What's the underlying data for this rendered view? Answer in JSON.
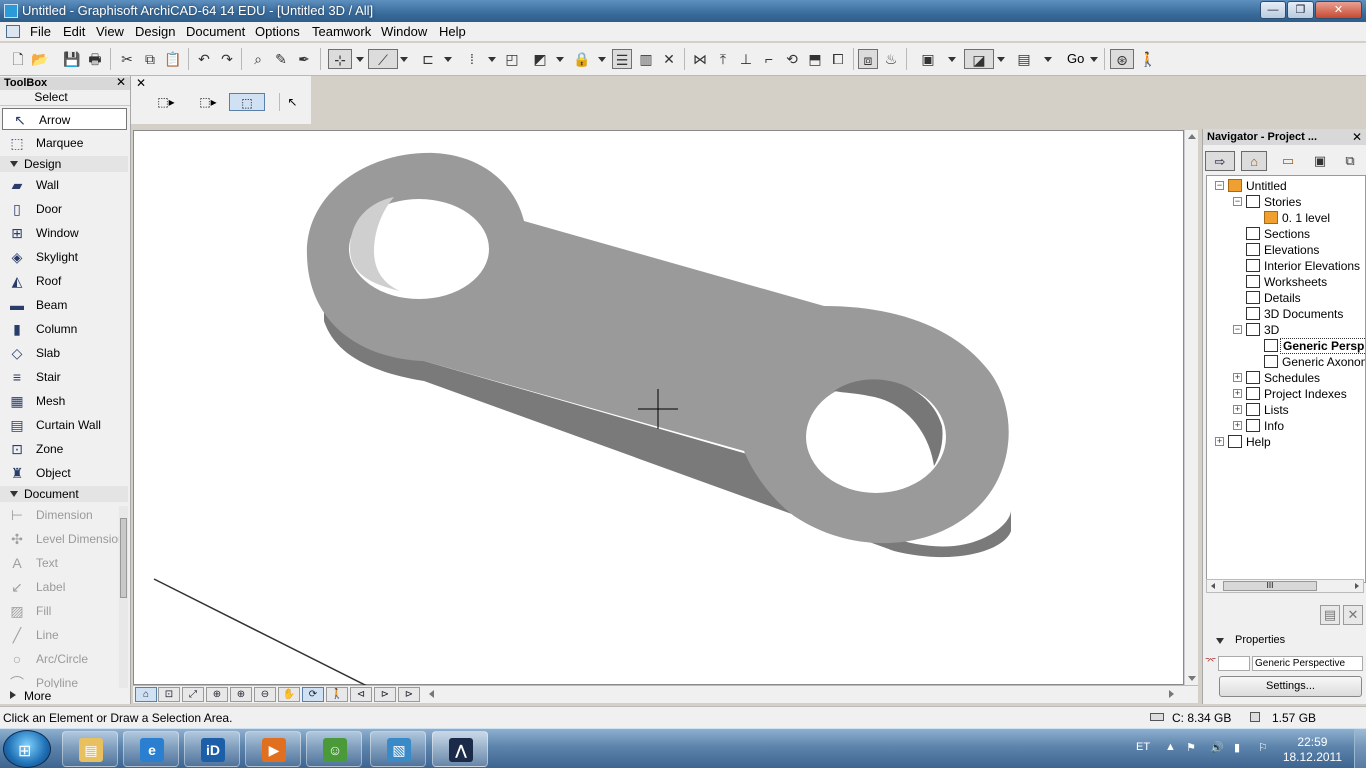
{
  "window": {
    "title": "Untitled - Graphisoft ArchiCAD-64 14 EDU - [Untitled 3D / All]",
    "minimize": "—",
    "restore": "❐",
    "close": "✕"
  },
  "menu": [
    "File",
    "Edit",
    "View",
    "Design",
    "Document",
    "Options",
    "Teamwork",
    "Window",
    "Help"
  ],
  "toolbar": {
    "go_label": "Go"
  },
  "toolbox": {
    "title": "ToolBox",
    "close": "✕",
    "select_label": "Select",
    "select_tools": [
      {
        "label": "Arrow",
        "icon": "↖"
      },
      {
        "label": "Marquee",
        "icon": "⬚"
      }
    ],
    "design_label": "Design",
    "design_tools": [
      {
        "label": "Wall",
        "icon": "▰"
      },
      {
        "label": "Door",
        "icon": "▯"
      },
      {
        "label": "Window",
        "icon": "⊞"
      },
      {
        "label": "Skylight",
        "icon": "◈"
      },
      {
        "label": "Roof",
        "icon": "◭"
      },
      {
        "label": "Beam",
        "icon": "▬"
      },
      {
        "label": "Column",
        "icon": "▮"
      },
      {
        "label": "Slab",
        "icon": "◇"
      },
      {
        "label": "Stair",
        "icon": "≡"
      },
      {
        "label": "Mesh",
        "icon": "▦"
      },
      {
        "label": "Curtain Wall",
        "icon": "▤"
      },
      {
        "label": "Zone",
        "icon": "⊡"
      },
      {
        "label": "Object",
        "icon": "♜"
      }
    ],
    "document_label": "Document",
    "document_tools": [
      {
        "label": "Dimension",
        "icon": "⊢"
      },
      {
        "label": "Level Dimension",
        "icon": "✣"
      },
      {
        "label": "Text",
        "icon": "A"
      },
      {
        "label": "Label",
        "icon": "↙"
      },
      {
        "label": "Fill",
        "icon": "▨"
      },
      {
        "label": "Line",
        "icon": "╱"
      },
      {
        "label": "Arc/Circle",
        "icon": "○"
      },
      {
        "label": "Polyline",
        "icon": "⌒"
      }
    ],
    "more_label": "More"
  },
  "infobox": {
    "close": "✕"
  },
  "navigator": {
    "title": "Navigator - Project ...",
    "close": "✕",
    "tree": [
      {
        "label": "Untitled",
        "level": 0,
        "exp": "−"
      },
      {
        "label": "Stories",
        "level": 1,
        "exp": "−"
      },
      {
        "label": "0. 1 level",
        "level": 2,
        "exp": ""
      },
      {
        "label": "Sections",
        "level": 1,
        "exp": ""
      },
      {
        "label": "Elevations",
        "level": 1,
        "exp": ""
      },
      {
        "label": "Interior Elevations",
        "level": 1,
        "exp": ""
      },
      {
        "label": "Worksheets",
        "level": 1,
        "exp": ""
      },
      {
        "label": "Details",
        "level": 1,
        "exp": ""
      },
      {
        "label": "3D Documents",
        "level": 1,
        "exp": ""
      },
      {
        "label": "3D",
        "level": 1,
        "exp": "−"
      },
      {
        "label": "Generic Persp",
        "level": 2,
        "exp": ""
      },
      {
        "label": "Generic Axonom",
        "level": 2,
        "exp": ""
      },
      {
        "label": "Schedules",
        "level": 1,
        "exp": "+"
      },
      {
        "label": "Project Indexes",
        "level": 1,
        "exp": "+"
      },
      {
        "label": "Lists",
        "level": 1,
        "exp": "+"
      },
      {
        "label": "Info",
        "level": 1,
        "exp": "+"
      },
      {
        "label": "Help",
        "level": 0,
        "exp": "+"
      }
    ],
    "scroll_grip": "III",
    "properties_label": "Properties",
    "properties_value": "Generic Perspective",
    "settings_button": "Settings..."
  },
  "status": {
    "message": "Click an Element or Draw a Selection Area.",
    "disk_c": "C: 8.34 GB",
    "memory": "1.57 GB"
  },
  "taskbar": {
    "lang": "ET",
    "time": "22:59",
    "date": "18.12.2011"
  }
}
